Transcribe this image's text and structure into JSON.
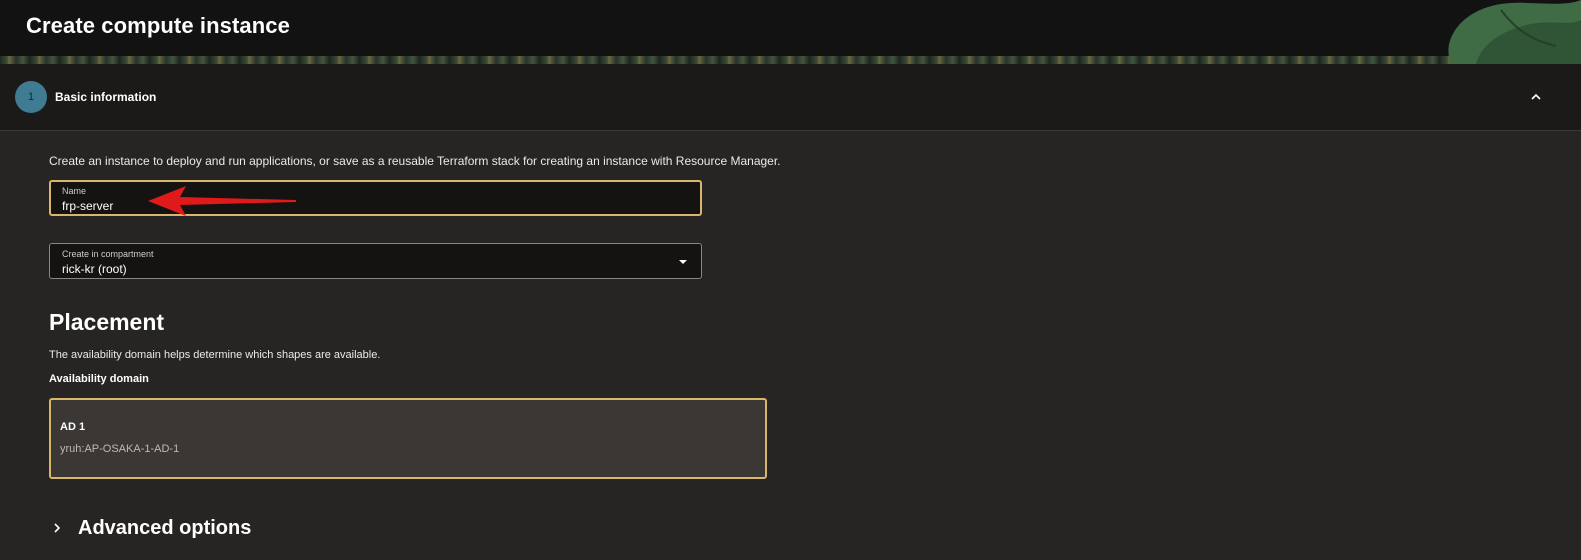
{
  "header": {
    "title": "Create compute instance"
  },
  "section": {
    "step_number": "1",
    "title": "Basic information",
    "collapse_icon": "chevron-up-icon"
  },
  "intro_text": "Create an instance to deploy and run applications, or save as a reusable Terraform stack for creating an instance with Resource Manager.",
  "name_field": {
    "label": "Name",
    "value": "frp-server"
  },
  "compartment_field": {
    "label": "Create in compartment",
    "value": "rick-kr (root)",
    "icon": "caret-down-icon"
  },
  "placement": {
    "heading": "Placement",
    "description": "The availability domain helps determine which shapes are available.",
    "ad_label": "Availability domain",
    "options": [
      {
        "name": "AD 1",
        "id": "yruh:AP-OSAKA-1-AD-1",
        "selected": true
      }
    ]
  },
  "advanced": {
    "label": "Advanced options",
    "icon": "chevron-right-icon"
  },
  "colors": {
    "accent_border": "#d9b76a",
    "step_circle": "#3f7c94",
    "annotation_arrow": "#e0191b"
  }
}
